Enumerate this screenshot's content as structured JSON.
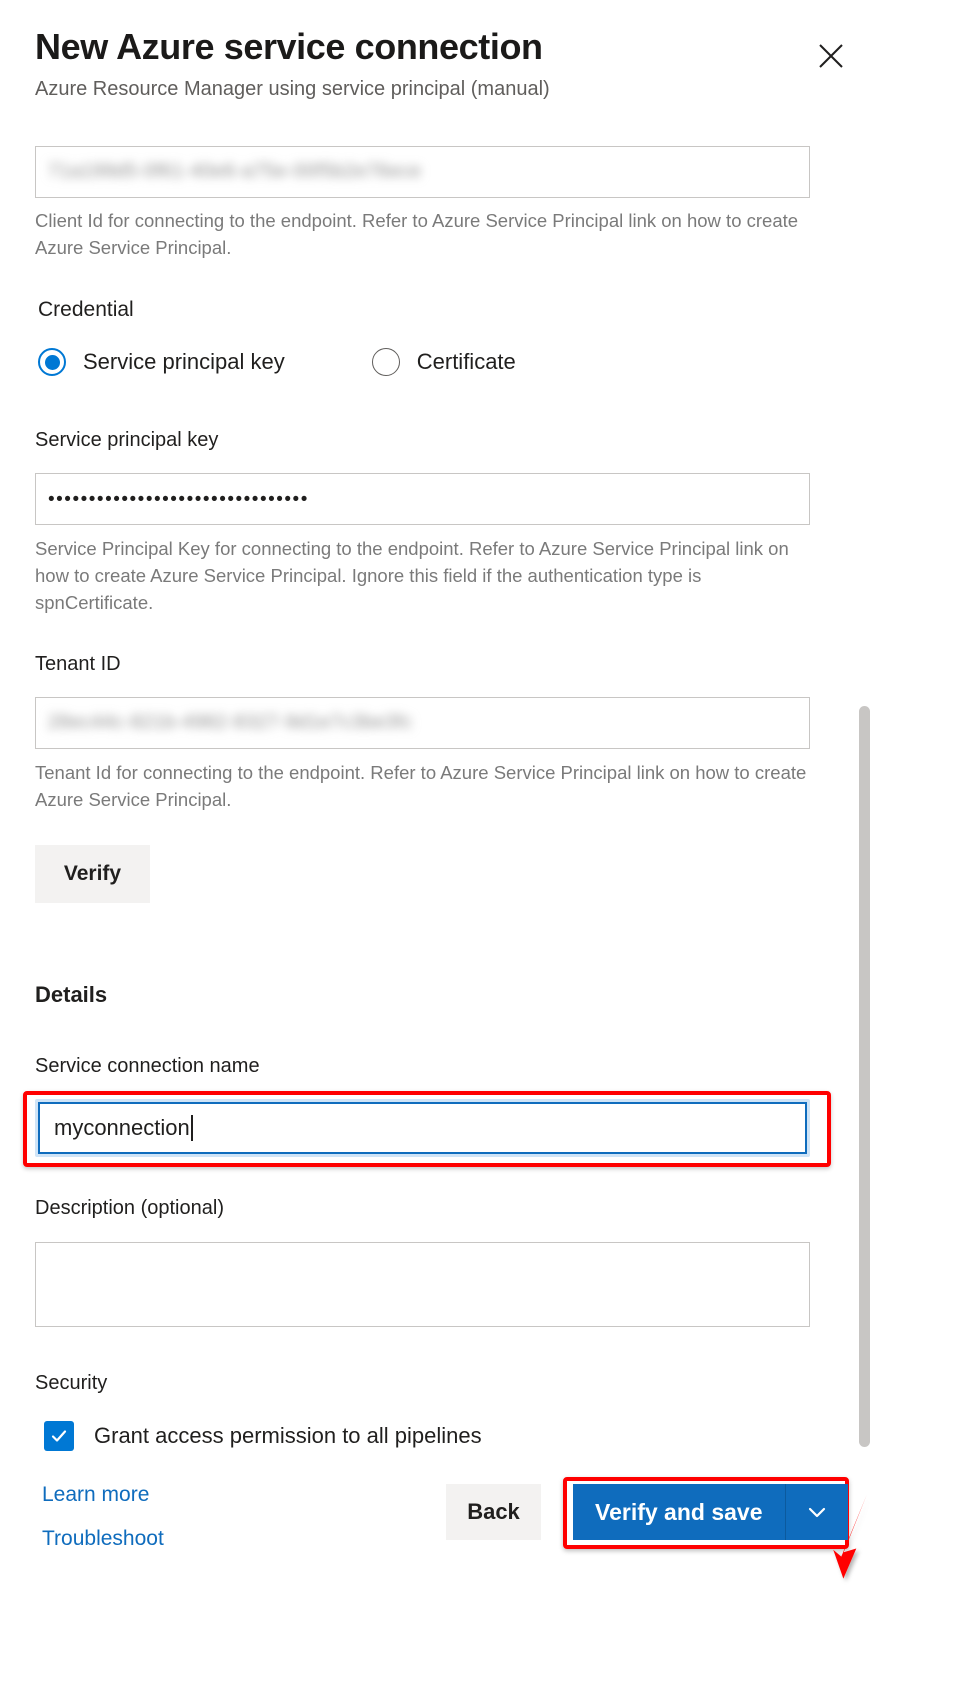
{
  "dialog": {
    "title": "New Azure service connection",
    "subtitle": "Azure Resource Manager using service principal (manual)",
    "close_icon": "close-icon"
  },
  "fields": {
    "client_id": {
      "value": "71a199d5-0f61-40e6-a75e-00f5b2e76ece",
      "hint": "Client Id for connecting to the endpoint. Refer to Azure Service Principal link on how to create Azure Service Principal."
    },
    "credential": {
      "label": "Credential",
      "options": [
        {
          "label": "Service principal key",
          "selected": true
        },
        {
          "label": "Certificate",
          "selected": false
        }
      ]
    },
    "service_principal_key": {
      "label": "Service principal key",
      "value": "••••••••••••••••••••••••••••••••",
      "hint": "Service Principal Key for connecting to the endpoint. Refer to Azure Service Principal link on how to create Azure Service Principal. Ignore this field if the authentication type is spnCertificate."
    },
    "tenant_id": {
      "label": "Tenant ID",
      "value": "28ec44c-821b-4982-8327-9d1e7c3be3fc",
      "hint": "Tenant Id for connecting to the endpoint. Refer to Azure Service Principal link on how to create Azure Service Principal."
    },
    "verify_button": "Verify",
    "details_heading": "Details",
    "service_connection_name": {
      "label": "Service connection name",
      "value": "myconnection"
    },
    "description": {
      "label": "Description (optional)",
      "value": ""
    },
    "security": {
      "heading": "Security",
      "grant_access_label": "Grant access permission to all pipelines",
      "grant_access_checked": true
    }
  },
  "footer": {
    "learn_more": "Learn more",
    "troubleshoot": "Troubleshoot",
    "back_button": "Back",
    "save_button": "Verify and save",
    "save_caret_icon": "chevron-down-icon"
  },
  "colors": {
    "accent": "#0f6cbd",
    "radio_accent": "#0078d4",
    "checkbox": "#0078d4",
    "highlight": "#ff0000",
    "link": "#0f6cbd",
    "neutral_button": "#f3f2f1",
    "field_border": "#c8c6c4",
    "scrollbar": "#c8c6c4",
    "hint_text": "#7a7a7a"
  }
}
